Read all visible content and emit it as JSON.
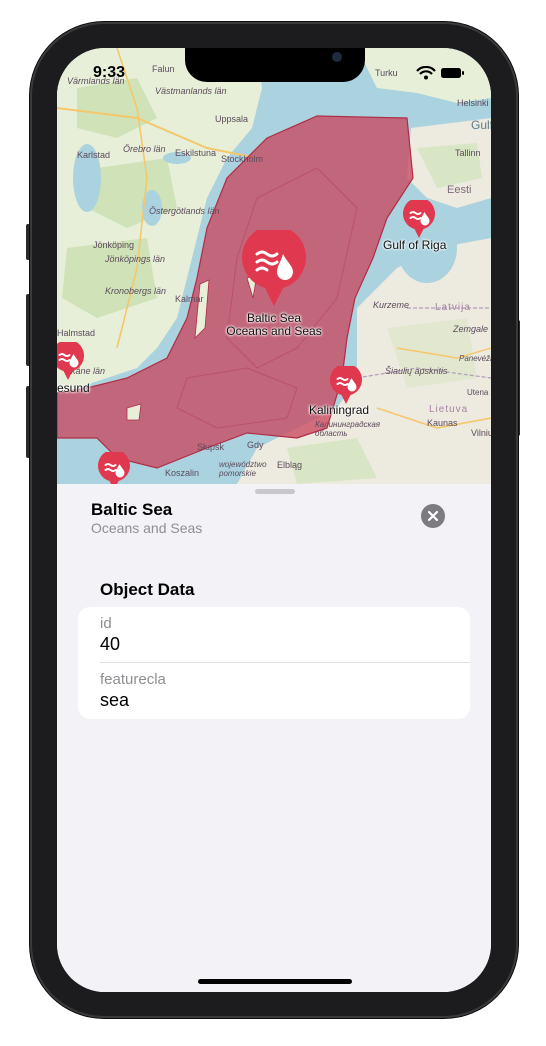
{
  "status": {
    "time": "9:33"
  },
  "map": {
    "labels": [
      {
        "text": "Falun"
      },
      {
        "text": "Uppsala"
      },
      {
        "text": "Värmlands län"
      },
      {
        "text": "Västmanlands län"
      },
      {
        "text": "Karlstad"
      },
      {
        "text": "Örebro län"
      },
      {
        "text": "Eskilstuna"
      },
      {
        "text": "Stockholm"
      },
      {
        "text": "Östergötlands län"
      },
      {
        "text": "Jönköping"
      },
      {
        "text": "Jönköpings län"
      },
      {
        "text": "Kronobergs län"
      },
      {
        "text": "Kalmar"
      },
      {
        "text": "Halmstad"
      },
      {
        "text": "Skåne län"
      },
      {
        "text": "Turku"
      },
      {
        "text": "Helsinki"
      },
      {
        "text": "Gulf"
      },
      {
        "text": "Tallinn"
      },
      {
        "text": "Eesti"
      },
      {
        "text": "Latvija"
      },
      {
        "text": "Kurzeme"
      },
      {
        "text": "Zemgale"
      },
      {
        "text": "Šiaulių apskritis"
      },
      {
        "text": "Panevėžio apskritis"
      },
      {
        "text": "Lietuva"
      },
      {
        "text": "Kaunas"
      },
      {
        "text": "Vilniu"
      },
      {
        "text": "Калининградская область"
      },
      {
        "text": "Słupsk"
      },
      {
        "text": "Gdy"
      },
      {
        "text": "Koszalin"
      },
      {
        "text": "Elbląg"
      },
      {
        "text": "województwo pomorskie"
      },
      {
        "text": "Utena"
      }
    ],
    "pins": [
      {
        "name": "Baltic Sea",
        "subtitle": "Oceans and Seas",
        "color": "#e0384f",
        "selected": true
      },
      {
        "name": "Gulf of Riga",
        "subtitle": "",
        "color": "#e0384f"
      },
      {
        "name": "Kaliningrad",
        "subtitle": "",
        "color": "#e0384f"
      },
      {
        "name": "esund",
        "subtitle": "",
        "color": "#e0384f"
      },
      {
        "name": "",
        "subtitle": "",
        "color": "#e0384f"
      }
    ],
    "polygon_color": "#c9485f"
  },
  "sheet": {
    "title": "Baltic Sea",
    "subtitle": "Oceans and Seas",
    "close_icon": "xmark-circle-icon",
    "section_title": "Object Data",
    "rows": [
      {
        "key": "id",
        "value": "40"
      },
      {
        "key": "featurecla",
        "value": "sea"
      }
    ]
  }
}
